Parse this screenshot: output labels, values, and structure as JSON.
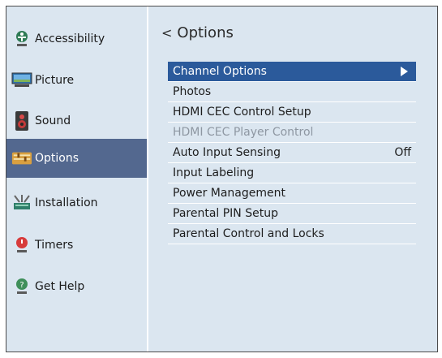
{
  "sidebar": {
    "items": [
      {
        "label": "Accessibility",
        "icon": "accessibility-icon"
      },
      {
        "label": "Picture",
        "icon": "picture-icon"
      },
      {
        "label": "Sound",
        "icon": "sound-icon"
      },
      {
        "label": "Options",
        "icon": "options-icon",
        "active": true
      },
      {
        "label": "Installation",
        "icon": "installation-icon"
      },
      {
        "label": "Timers",
        "icon": "timers-icon"
      },
      {
        "label": "Get Help",
        "icon": "help-icon"
      }
    ]
  },
  "main": {
    "back_glyph": "<",
    "title": "Options",
    "menu": [
      {
        "label": "Channel Options",
        "state": "selected"
      },
      {
        "label": "Photos"
      },
      {
        "label": "HDMI CEC Control Setup"
      },
      {
        "label": "HDMI CEC Player Control",
        "state": "disabled"
      },
      {
        "label": "Auto Input Sensing",
        "value": "Off"
      },
      {
        "label": "Input Labeling"
      },
      {
        "label": "Power Management"
      },
      {
        "label": "Parental PIN Setup"
      },
      {
        "label": "Parental Control and Locks"
      }
    ]
  },
  "colors": {
    "background": "#dbe6f0",
    "active_sidebar": "#53688f",
    "selected_menu": "#2b5a9b",
    "disabled_text": "#8e97a2"
  }
}
